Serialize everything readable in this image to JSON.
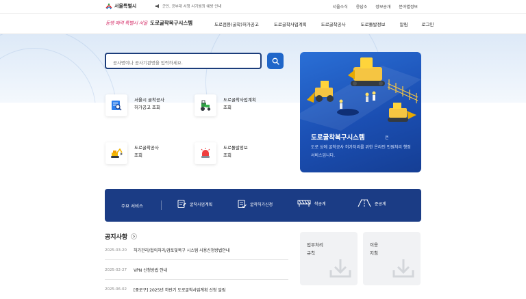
{
  "topbar": {
    "logo_text": "서울특별시",
    "notice_text": "군인, 공부대 서청 사기범죄 예방 안내",
    "links": [
      "서울소식",
      "응답소",
      "정보공개",
      "분야별정보"
    ]
  },
  "gnb": {
    "brand_script": "동행 매력 특별시 서울",
    "brand_name": "도로굴착복구시스템",
    "menu": [
      "도로점용(굴착)허가공고",
      "도로굴착사업계획",
      "도로굴착공사",
      "도로돌발정보",
      "알림",
      "로그인"
    ]
  },
  "search": {
    "placeholder": "공사명이나 공사기관명을 입력하세요."
  },
  "quick_links": [
    {
      "label": "서울시 굴착공사\n허가공고 조회",
      "icon": "search-document-icon"
    },
    {
      "label": "도로굴착사업계획\n조회",
      "icon": "tractor-icon"
    },
    {
      "label": "도로굴착공사\n조회",
      "icon": "excavator-icon"
    },
    {
      "label": "도로돌발정보\n조회",
      "icon": "siren-icon"
    }
  ],
  "promo": {
    "title": "도로굴착복구시스템",
    "title_suffix": "은",
    "desc": "도로 상에 굴착공사 허가처리를 위한 온라인 민원처리 행정서비스입니다."
  },
  "services": {
    "title": "주요 서비스",
    "items": [
      {
        "label": "굴착사업계획",
        "icon": "plan-document-icon"
      },
      {
        "label": "굴착허가신청",
        "icon": "permit-document-icon"
      },
      {
        "label": "착공계",
        "icon": "barrier-icon"
      },
      {
        "label": "준공계",
        "icon": "road-icon"
      }
    ]
  },
  "notices": {
    "title": "공지사항",
    "items": [
      {
        "date": "2025-03-20",
        "text": "허가관리/협의처리/검토및복구 시스템 사용신청방법안내"
      },
      {
        "date": "2025-02-27",
        "text": "VPN 신청방법 안내"
      },
      {
        "date": "2025-06-02",
        "text": "[중로구] 2025년 하반기 도로굴착사업계획 신청 알림"
      }
    ]
  },
  "downloads": [
    {
      "label": "업무처리\n규칙",
      "icon": "download-icon"
    },
    {
      "label": "이용\n지침",
      "icon": "download-icon"
    }
  ],
  "colors": {
    "primary_navy": "#1b3c85",
    "search_blue": "#1f66c9",
    "promo_blue": "#1b4fb3",
    "brand_pink": "#d6336c"
  }
}
